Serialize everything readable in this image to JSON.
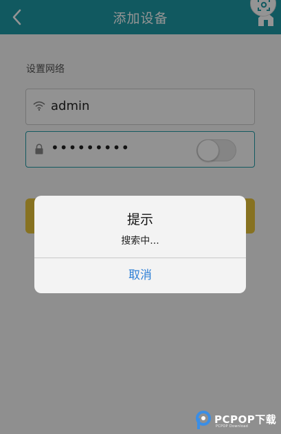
{
  "header": {
    "title": "添加设备",
    "back_icon": "chevron-left-icon",
    "home_icon": "home-icon",
    "scan_icon": "scan-icon"
  },
  "form": {
    "section_label": "设置网络",
    "ssid": {
      "icon": "wifi-icon",
      "value": "admin"
    },
    "password": {
      "icon": "lock-icon",
      "value": "•••••••••",
      "show_password_toggle": "off"
    }
  },
  "dialog": {
    "title": "提示",
    "message": "搜索中...",
    "cancel_label": "取消"
  },
  "watermark": {
    "brand": "PCPOP下载",
    "tagline": "PCPOP Download"
  },
  "colors": {
    "header_bg": "#1e9aa5",
    "accent_border": "#1e9aa5",
    "submit_bg": "#e8c43a",
    "dialog_action": "#2d7fd6"
  }
}
